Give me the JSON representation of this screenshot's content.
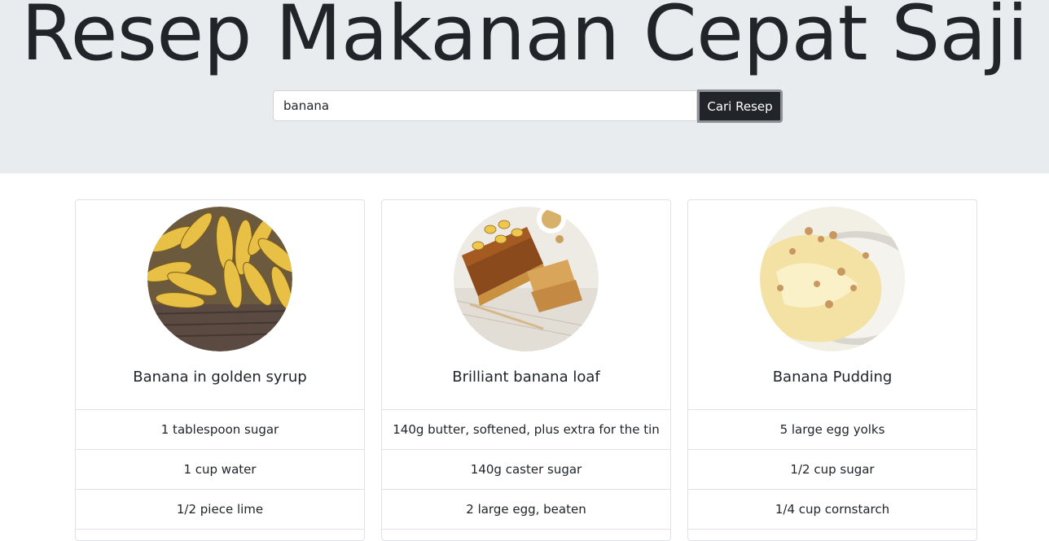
{
  "header": {
    "title": "Resep Makanan Cepat Saji"
  },
  "search": {
    "value": "banana",
    "button_label": "Cari Resep"
  },
  "recipes": [
    {
      "title": "Banana in golden syrup",
      "image": "bananas-in-basket-photo",
      "ingredients": [
        "1 tablespoon sugar",
        "1 cup water",
        "1/2 piece lime"
      ]
    },
    {
      "title": "Brilliant banana loaf",
      "image": "banana-loaf-photo",
      "ingredients": [
        "140g butter, softened, plus extra for the tin",
        "140g caster sugar",
        "2 large egg, beaten"
      ]
    },
    {
      "title": "Banana Pudding",
      "image": "banana-pudding-photo",
      "ingredients": [
        "5 large egg yolks",
        "1/2 cup sugar",
        "1/4 cup cornstarch"
      ]
    }
  ]
}
